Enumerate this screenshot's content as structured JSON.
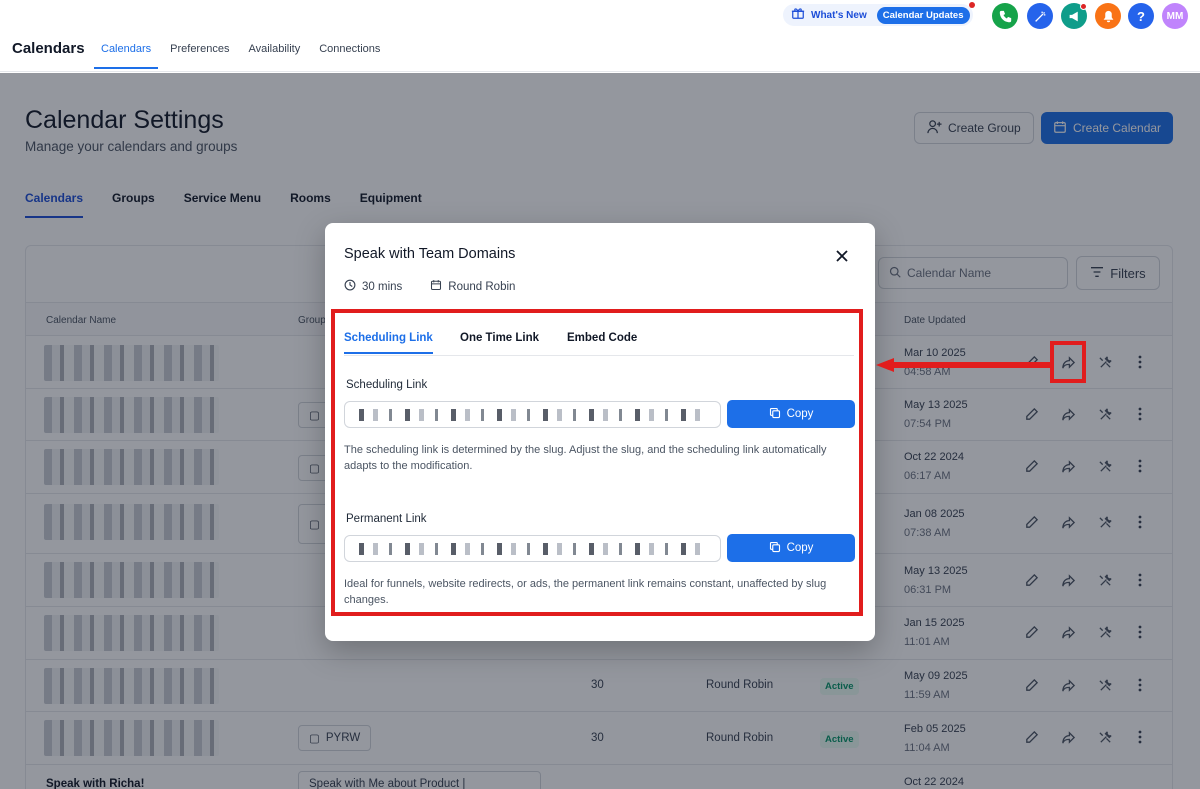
{
  "topbar": {
    "brand": "Calendars",
    "tabs": [
      "Calendars",
      "Preferences",
      "Availability",
      "Connections"
    ],
    "whats_new": "What's New",
    "updates_pill": "Calendar Updates",
    "avatar_initials": "MM",
    "help_glyph": "?"
  },
  "page": {
    "title": "Calendar Settings",
    "subtitle": "Manage your calendars and groups",
    "create_group": "Create Group",
    "create_calendar": "Create Calendar",
    "tabs": [
      "Calendars",
      "Groups",
      "Service Menu",
      "Rooms",
      "Equipment"
    ],
    "search_placeholder": "Calendar Name",
    "filters": "Filters"
  },
  "table": {
    "headers": {
      "name": "Calendar Name",
      "group": "Group",
      "date": "Date Updated"
    },
    "rows": [
      {
        "date": "Mar 10 2025",
        "time": "04:58 AM"
      },
      {
        "date": "May 13 2025",
        "time": "07:54 PM"
      },
      {
        "date": "Oct 22 2024",
        "time": "06:17 AM"
      },
      {
        "date": "Jan 08 2025",
        "time": "07:38 AM"
      },
      {
        "date": "May 13 2025",
        "time": "06:31 PM"
      },
      {
        "date": "Jan 15 2025",
        "time": "11:01 AM"
      },
      {
        "duration": "30",
        "type": "Round Robin",
        "status": "Active",
        "date": "May 09 2025",
        "time": "11:59 AM"
      },
      {
        "group": "PYRW",
        "duration": "30",
        "type": "Round Robin",
        "status": "Active",
        "date": "Feb 05 2025",
        "time": "11:04 AM"
      },
      {
        "name": "Speak with Richa!",
        "group": "Speak with Me about Product |",
        "date": "Oct 22 2024"
      }
    ]
  },
  "modal": {
    "title": "Speak with Team Domains",
    "duration": "30 mins",
    "type": "Round Robin",
    "tabs": [
      "Scheduling Link",
      "One Time Link",
      "Embed Code"
    ],
    "scheduling_label": "Scheduling Link",
    "scheduling_help": "The scheduling link is determined by the slug. Adjust the slug, and the scheduling link automatically adapts to the modification.",
    "permanent_label": "Permanent Link",
    "permanent_help": "Ideal for funnels, website redirects, or ads, the permanent link remains constant, unaffected by slug changes.",
    "copy_label": "Copy"
  },
  "colors": {
    "accent": "#1d6fe8",
    "annotation": "#e11d1d",
    "active_badge": "#059669"
  }
}
